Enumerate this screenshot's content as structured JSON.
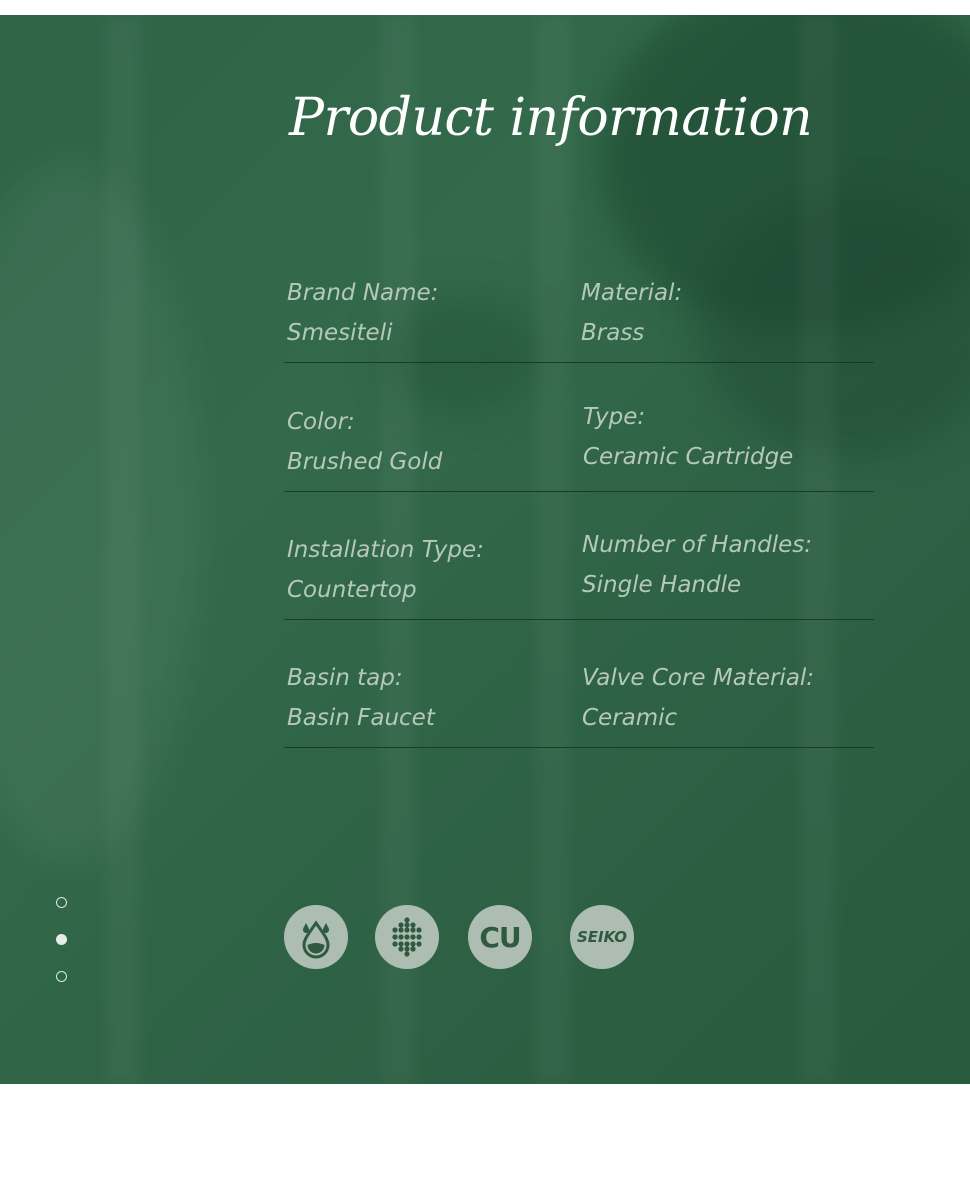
{
  "title": "Product information",
  "specs": [
    {
      "left_label": "Brand Name:",
      "left_value": "Smesiteli",
      "right_label": "Material:",
      "right_value": "Brass"
    },
    {
      "left_label": "Color:",
      "left_value": "Brushed Gold",
      "right_label": "Type:",
      "right_value": "Ceramic Cartridge"
    },
    {
      "left_label": "Installation Type:",
      "left_value": "Countertop",
      "right_label": "Number of Handles:",
      "right_value": "Single Handle"
    },
    {
      "left_label": "Basin tap:",
      "left_value": "Basin Faucet",
      "right_label": "Valve Core Material:",
      "right_value": "Ceramic"
    }
  ],
  "badges": [
    {
      "icon": "water-drop-icon"
    },
    {
      "icon": "honeycomb-dots-icon"
    },
    {
      "icon": "copper-icon",
      "text": "CU"
    },
    {
      "icon": "seiko-icon",
      "text": "SEIKO"
    }
  ],
  "carousel": {
    "count": 3,
    "active_index": 1
  },
  "colors": {
    "background": "#316647",
    "text": "#b6c8bc",
    "title": "#ffffff",
    "badge": "#adbdb2",
    "badge_mark": "#2f5a3f"
  }
}
